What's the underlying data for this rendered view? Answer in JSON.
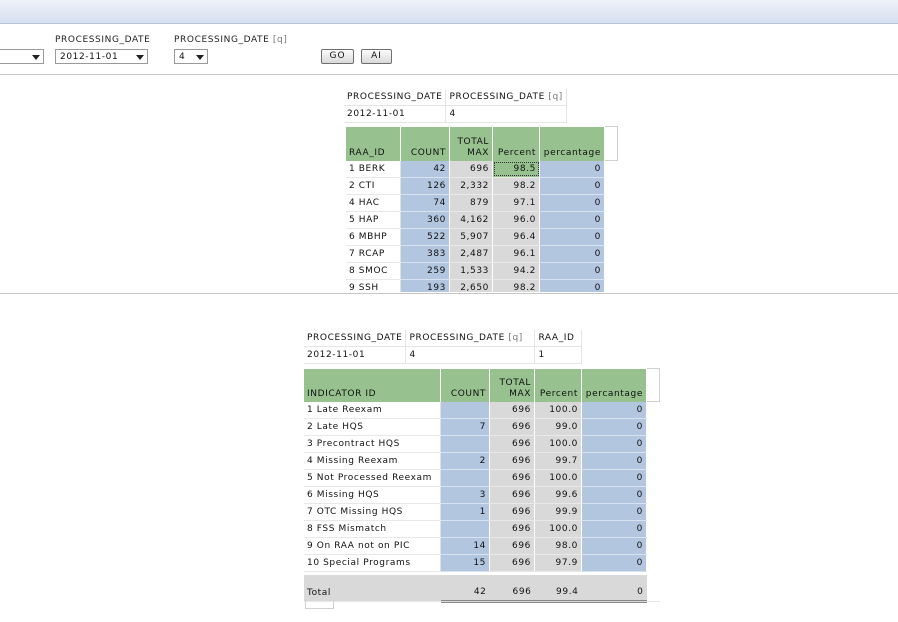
{
  "filters": {
    "processing_date_label": "PROCESSING_DATE",
    "processing_date_q_label": "PROCESSING_DATE",
    "q_suffix": "[q]",
    "processing_date_value": "2012-11-01",
    "processing_date_q_value": "4",
    "go_label": "GO",
    "ai_label": "AI"
  },
  "report1": {
    "header": {
      "col1": "PROCESSING_DATE",
      "col2": "PROCESSING_DATE",
      "q": "[q]",
      "val1": "2012-11-01",
      "val2": "4"
    },
    "columns": {
      "id": "RAA_ID",
      "count": "COUNT",
      "total_max_1": "TOTAL",
      "total_max_2": "MAX",
      "percent": "Percent",
      "percantage": "percantage"
    },
    "rows": [
      {
        "id": "1 BERK",
        "count": "42",
        "total_max": "696",
        "percent": "98.5",
        "percantage": "0"
      },
      {
        "id": "2 CTI",
        "count": "126",
        "total_max": "2,332",
        "percent": "98.2",
        "percantage": "0"
      },
      {
        "id": "4 HAC",
        "count": "74",
        "total_max": "879",
        "percent": "97.1",
        "percantage": "0"
      },
      {
        "id": "5 HAP",
        "count": "360",
        "total_max": "4,162",
        "percent": "96.0",
        "percantage": "0"
      },
      {
        "id": "6 MBHP",
        "count": "522",
        "total_max": "5,907",
        "percent": "96.4",
        "percantage": "0"
      },
      {
        "id": "7 RCAP",
        "count": "383",
        "total_max": "2,487",
        "percent": "96.1",
        "percantage": "0"
      },
      {
        "id": "8 SMOC",
        "count": "259",
        "total_max": "1,533",
        "percent": "94.2",
        "percantage": "0"
      },
      {
        "id": "9 SSH",
        "count": "193",
        "total_max": "2,650",
        "percent": "98.2",
        "percantage": "0"
      }
    ]
  },
  "report2": {
    "header": {
      "col1": "PROCESSING_DATE",
      "col2": "PROCESSING_DATE",
      "q": "[q]",
      "col3": "RAA_ID",
      "val1": "2012-11-01",
      "val2": "4",
      "val3": "1"
    },
    "columns": {
      "id": "INDICATOR ID",
      "count": "COUNT",
      "total_max_1": "TOTAL",
      "total_max_2": "MAX",
      "percent": "Percent",
      "percantage": "percantage"
    },
    "rows": [
      {
        "id": "1 Late Reexam",
        "count": "",
        "total_max": "696",
        "percent": "100.0",
        "percantage": "0"
      },
      {
        "id": "2 Late HQS",
        "count": "7",
        "total_max": "696",
        "percent": "99.0",
        "percantage": "0"
      },
      {
        "id": "3 Precontract HQS",
        "count": "",
        "total_max": "696",
        "percent": "100.0",
        "percantage": "0"
      },
      {
        "id": "4 Missing Reexam",
        "count": "2",
        "total_max": "696",
        "percent": "99.7",
        "percantage": "0"
      },
      {
        "id": "5 Not Processed Reexam",
        "count": "",
        "total_max": "696",
        "percent": "100.0",
        "percantage": "0"
      },
      {
        "id": "6 Missing HQS",
        "count": "3",
        "total_max": "696",
        "percent": "99.6",
        "percantage": "0"
      },
      {
        "id": "7 OTC Missing HQS",
        "count": "1",
        "total_max": "696",
        "percent": "99.9",
        "percantage": "0"
      },
      {
        "id": "8 FSS Mismatch",
        "count": "",
        "total_max": "696",
        "percent": "100.0",
        "percantage": "0"
      },
      {
        "id": "9 On RAA not on PIC",
        "count": "14",
        "total_max": "696",
        "percent": "98.0",
        "percantage": "0"
      },
      {
        "id": "10 Special Programs",
        "count": "15",
        "total_max": "696",
        "percent": "97.9",
        "percantage": "0"
      }
    ],
    "total": {
      "label": "Total",
      "count": "42",
      "total_max": "696",
      "percent": "99.4",
      "percantage": "0"
    }
  }
}
